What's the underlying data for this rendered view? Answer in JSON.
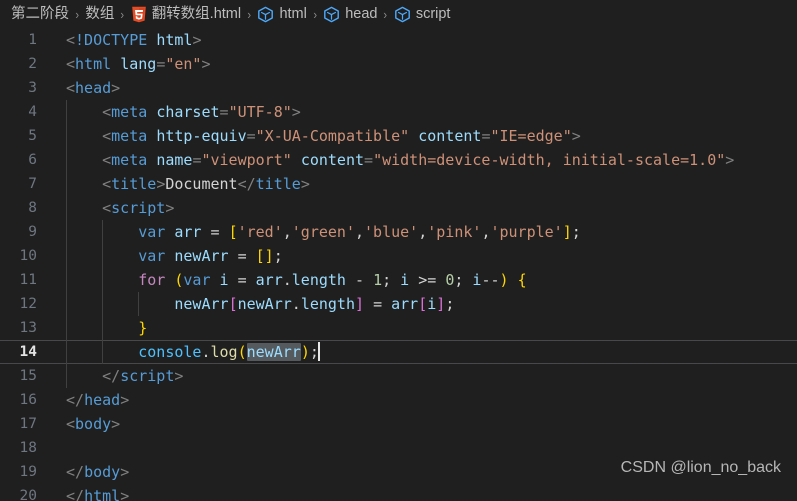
{
  "breadcrumb": {
    "items": [
      {
        "label": "第二阶段",
        "icon": null
      },
      {
        "label": "数组",
        "icon": null
      },
      {
        "label": "翻转数组.html",
        "icon": "html5-icon"
      },
      {
        "label": "html",
        "icon": "symbol-cube-icon"
      },
      {
        "label": "head",
        "icon": "symbol-cube-icon"
      },
      {
        "label": "script",
        "icon": "symbol-cube-icon"
      }
    ],
    "separator": "›"
  },
  "editor": {
    "active_line": 14,
    "selected_word": "newArr",
    "line_numbers": [
      1,
      2,
      3,
      4,
      5,
      6,
      7,
      8,
      9,
      10,
      11,
      12,
      13,
      14,
      15,
      16,
      17,
      18,
      19,
      20
    ],
    "lines": [
      {
        "n": 1,
        "text": "<!DOCTYPE html>"
      },
      {
        "n": 2,
        "text": "<html lang=\"en\">"
      },
      {
        "n": 3,
        "text": "<head>"
      },
      {
        "n": 4,
        "text": "    <meta charset=\"UTF-8\">"
      },
      {
        "n": 5,
        "text": "    <meta http-equiv=\"X-UA-Compatible\" content=\"IE=edge\">"
      },
      {
        "n": 6,
        "text": "    <meta name=\"viewport\" content=\"width=device-width, initial-scale=1.0\">"
      },
      {
        "n": 7,
        "text": "    <title>Document</title>"
      },
      {
        "n": 8,
        "text": "    <script>"
      },
      {
        "n": 9,
        "text": "        var arr = ['red','green','blue','pink','purple'];"
      },
      {
        "n": 10,
        "text": "        var newArr = [];"
      },
      {
        "n": 11,
        "text": "        for (var i = arr.length - 1; i >= 0; i--) {"
      },
      {
        "n": 12,
        "text": "            newArr[newArr.length] = arr[i];"
      },
      {
        "n": 13,
        "text": "        }"
      },
      {
        "n": 14,
        "text": "        console.log(newArr);"
      },
      {
        "n": 15,
        "text": "    </script>"
      },
      {
        "n": 16,
        "text": "</head>"
      },
      {
        "n": 17,
        "text": "<body>"
      },
      {
        "n": 18,
        "text": ""
      },
      {
        "n": 19,
        "text": "</body>"
      },
      {
        "n": 20,
        "text": "</html>"
      }
    ]
  },
  "watermark": {
    "text": "CSDN @lion_no_back"
  },
  "colors": {
    "background": "#1f1f1f",
    "line_number": "#6e7681",
    "active_line_number": "#e4e4e4",
    "tag": "#569cd6",
    "attribute": "#9cdcfe",
    "string": "#ce9178",
    "keyword": "#569cd6",
    "control": "#c586c0",
    "function": "#dcdcaa",
    "number": "#b5cea8",
    "bracket_yellow": "#ffd700",
    "bracket_pink": "#da70d6",
    "bracket_blue": "#179fff",
    "punctuation": "#808080",
    "selection": "#555a5e",
    "indent_guide": "#404040",
    "html5_icon": "#e44d26",
    "symbol_icon": "#4daafc",
    "watermark": "#b6b6b6"
  }
}
